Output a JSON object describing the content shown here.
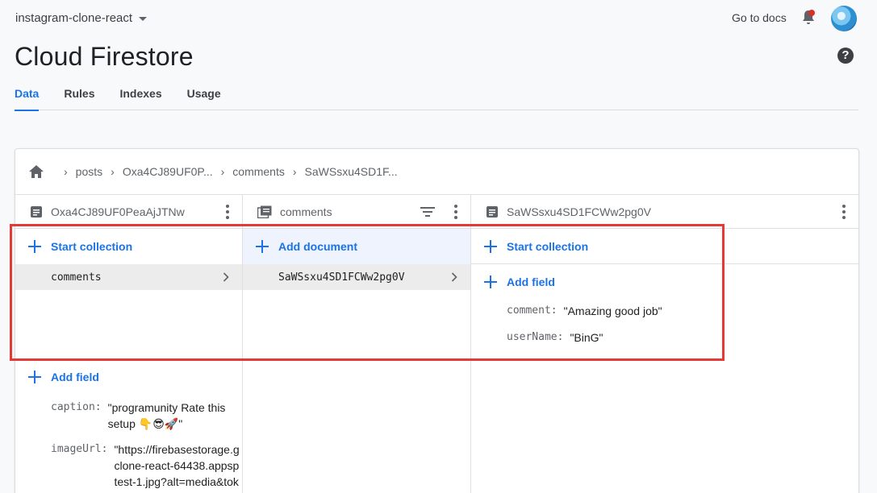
{
  "header": {
    "project_name": "instagram-clone-react",
    "go_to_docs": "Go to docs",
    "page_title": "Cloud Firestore",
    "help_glyph": "?"
  },
  "tabs": [
    {
      "label": "Data",
      "active": true
    },
    {
      "label": "Rules",
      "active": false
    },
    {
      "label": "Indexes",
      "active": false
    },
    {
      "label": "Usage",
      "active": false
    }
  ],
  "breadcrumb": [
    "posts",
    "Oxa4CJ89UF0P...",
    "comments",
    "SaWSsxu4SD1F..."
  ],
  "columns": {
    "document_parent": {
      "title": "Oxa4CJ89UF0PeaAjJTNw",
      "start_collection": "Start collection",
      "collections": [
        "comments"
      ],
      "add_field": "Add field",
      "fields": [
        {
          "key": "caption:",
          "value": "\"programunity Rate this setup 👇😎🚀\""
        },
        {
          "key": "imageUrl:",
          "value": "\"https://firebasestorage.g clone-react-64438.appsp test-1.jpg?alt=media&tok"
        }
      ]
    },
    "collection": {
      "title": "comments",
      "add_document": "Add document",
      "documents": [
        "SaWSsxu4SD1FCWw2pg0V"
      ]
    },
    "document": {
      "title": "SaWSsxu4SD1FCWw2pg0V",
      "start_collection": "Start collection",
      "add_field": "Add field",
      "fields": [
        {
          "key": "comment:",
          "value": "\"Amazing good job\""
        },
        {
          "key": "userName:",
          "value": "\"BinG\""
        }
      ]
    }
  },
  "colors": {
    "accent": "#1a73e8",
    "notification": "#d93025",
    "highlight_box": "#e53935"
  },
  "icons": [
    "chevron-down-icon",
    "bell-icon",
    "avatar",
    "help-icon",
    "home-icon",
    "document-icon",
    "collection-icon",
    "filter-icon",
    "more-vert-icon",
    "add-icon",
    "chevron-right-icon"
  ]
}
